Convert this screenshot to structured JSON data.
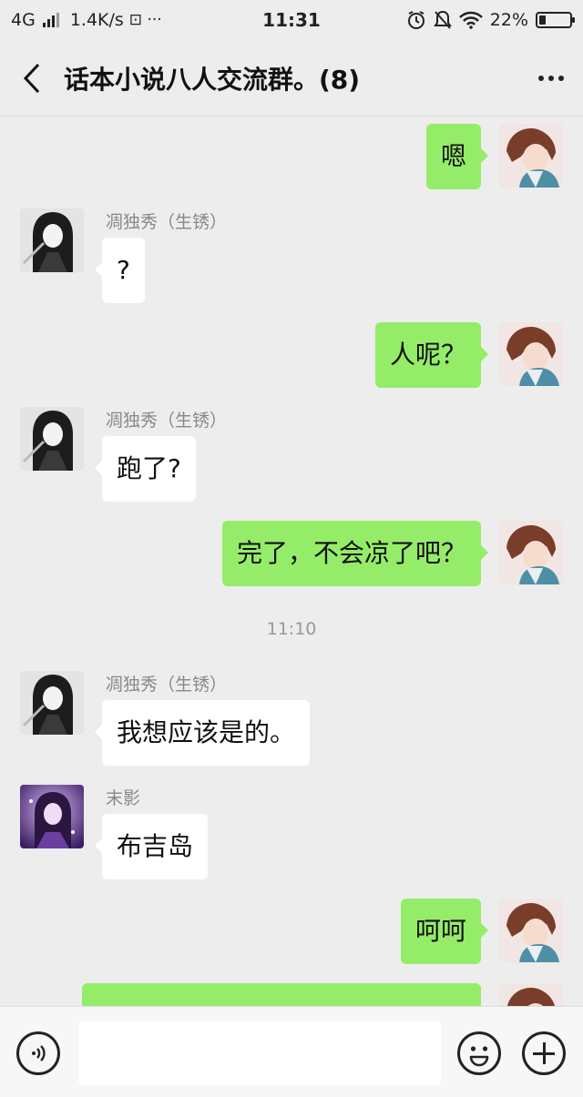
{
  "status_bar": {
    "network": "4G",
    "speed": "1.4K/s",
    "extra": "⊡ ···",
    "time": "11:31",
    "battery_text": "22%",
    "battery_level": 0.22
  },
  "header": {
    "title": "话本小说八人交流群。(8)"
  },
  "messages": [
    {
      "side": "out",
      "text": "嗯"
    },
    {
      "side": "in",
      "sender": "凋独秀（生锈）",
      "text": "?"
    },
    {
      "side": "out",
      "text": "人呢？"
    },
    {
      "side": "in",
      "sender": "凋独秀（生锈）",
      "text": "跑了?"
    },
    {
      "side": "out",
      "text": "完了，不会凉了吧？"
    },
    {
      "type": "time",
      "text": "11:10"
    },
    {
      "side": "in",
      "sender": "凋独秀（生锈）",
      "text": "我想应该是的。"
    },
    {
      "side": "in",
      "sender": "末影",
      "text": "布吉岛"
    },
    {
      "side": "out",
      "text": "呵呵"
    }
  ],
  "input": {
    "placeholder": ""
  }
}
